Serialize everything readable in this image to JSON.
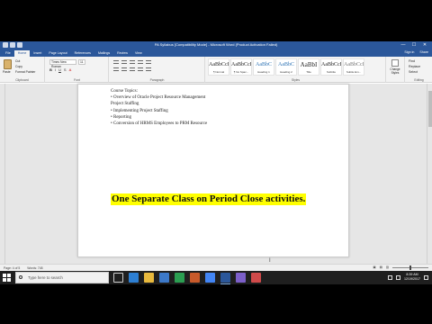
{
  "window": {
    "title": "PA Syllabus [Compatibility Mode] - Microsoft Word (Product Activation Failed)",
    "controls": [
      "—",
      "☐",
      "✕"
    ]
  },
  "tabs": [
    "File",
    "Home",
    "Insert",
    "Page Layout",
    "References",
    "Mailings",
    "Review",
    "View"
  ],
  "user": {
    "sign_in": "Sign in",
    "share": "Share"
  },
  "ribbon": {
    "clipboard": {
      "label": "Clipboard",
      "paste": "Paste",
      "cut": "Cut",
      "copy": "Copy",
      "format_painter": "Format Painter"
    },
    "font": {
      "label": "Font",
      "name": "Times New Roman",
      "size": "11"
    },
    "paragraph": {
      "label": "Paragraph"
    },
    "styles": {
      "label": "Styles",
      "items": [
        {
          "sample": "AaBbCcI",
          "name": "¶ Normal"
        },
        {
          "sample": "AaBbCcI",
          "name": "¶ No Spac..."
        },
        {
          "sample": "AaBbC",
          "name": "Heading 1"
        },
        {
          "sample": "AaBbC",
          "name": "Heading 2"
        },
        {
          "sample": "AaBbI",
          "name": "Title"
        },
        {
          "sample": "AaBbCcI",
          "name": "Subtitle"
        },
        {
          "sample": "AaBbCcI",
          "name": "Subtle Em..."
        }
      ],
      "change_styles": "Change Styles"
    },
    "editing": {
      "label": "Editing",
      "find": "Find",
      "replace": "Replace",
      "select": "Select"
    }
  },
  "document": {
    "lines": [
      "Course Topics:",
      "• Overview of Oracle Project Resource Management",
      "Project Staffing",
      "• Implementing Project Staffing",
      "• Reporting",
      "• Conversion of HRMS Employees to PRM Resource"
    ],
    "highlighted": "One Separate Class on Period Close activities."
  },
  "status": {
    "page": "Page: 4 of 5",
    "words": "Words: 748"
  },
  "taskbar": {
    "search_placeholder": "Type here to search",
    "time": "8:39 AM",
    "date": "12/19/2017"
  }
}
